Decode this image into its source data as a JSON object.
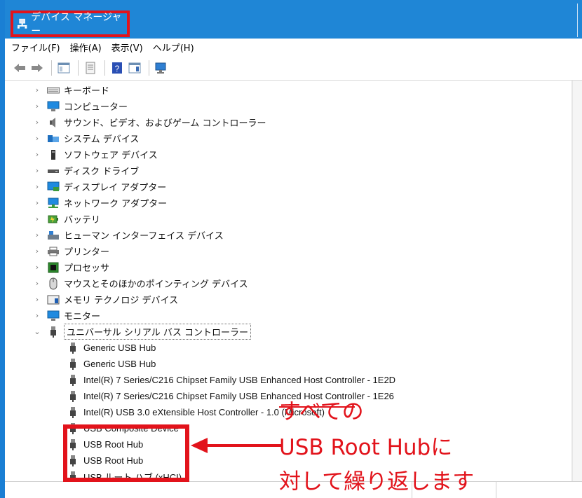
{
  "window": {
    "title": "デバイス マネージャー"
  },
  "menu": [
    "ファイル(F)",
    "操作(A)",
    "表示(V)",
    "ヘルプ(H)"
  ],
  "tree": {
    "categories": [
      {
        "label": "キーボード",
        "icon": "keyboard-icon"
      },
      {
        "label": "コンピューター",
        "icon": "computer-icon"
      },
      {
        "label": "サウンド、ビデオ、およびゲーム コントローラー",
        "icon": "speaker-icon"
      },
      {
        "label": "システム デバイス",
        "icon": "system-folder-icon"
      },
      {
        "label": "ソフトウェア デバイス",
        "icon": "software-device-icon"
      },
      {
        "label": "ディスク ドライブ",
        "icon": "disk-drive-icon"
      },
      {
        "label": "ディスプレイ アダプター",
        "icon": "display-adapter-icon"
      },
      {
        "label": "ネットワーク アダプター",
        "icon": "network-adapter-icon"
      },
      {
        "label": "バッテリ",
        "icon": "battery-icon"
      },
      {
        "label": "ヒューマン インターフェイス デバイス",
        "icon": "hid-icon"
      },
      {
        "label": "プリンター",
        "icon": "printer-icon"
      },
      {
        "label": "プロセッサ",
        "icon": "processor-icon"
      },
      {
        "label": "マウスとそのほかのポインティング デバイス",
        "icon": "mouse-icon"
      },
      {
        "label": "メモリ テクノロジ デバイス",
        "icon": "memory-icon"
      },
      {
        "label": "モニター",
        "icon": "monitor-icon"
      },
      {
        "label": "ユニバーサル シリアル バス コントローラー",
        "icon": "usb-icon",
        "expanded": true
      }
    ],
    "usb_children": [
      "Generic USB Hub",
      "Generic USB Hub",
      "Intel(R) 7 Series/C216 Chipset Family USB Enhanced Host Controller - 1E2D",
      "Intel(R) 7 Series/C216 Chipset Family USB Enhanced Host Controller - 1E26",
      "Intel(R) USB 3.0 eXtensible Host Controller - 1.0 (Microsoft)",
      "USB Composite Device",
      "USB Root Hub",
      "USB Root Hub",
      "USB ルート ハブ (xHCI)"
    ]
  },
  "annotation": {
    "line1": "すべての",
    "line2": "USB Root Hubに",
    "line3": "対して繰り返します"
  },
  "colors": {
    "title_bar": "#1f86d6",
    "highlight": "#e2131b"
  }
}
